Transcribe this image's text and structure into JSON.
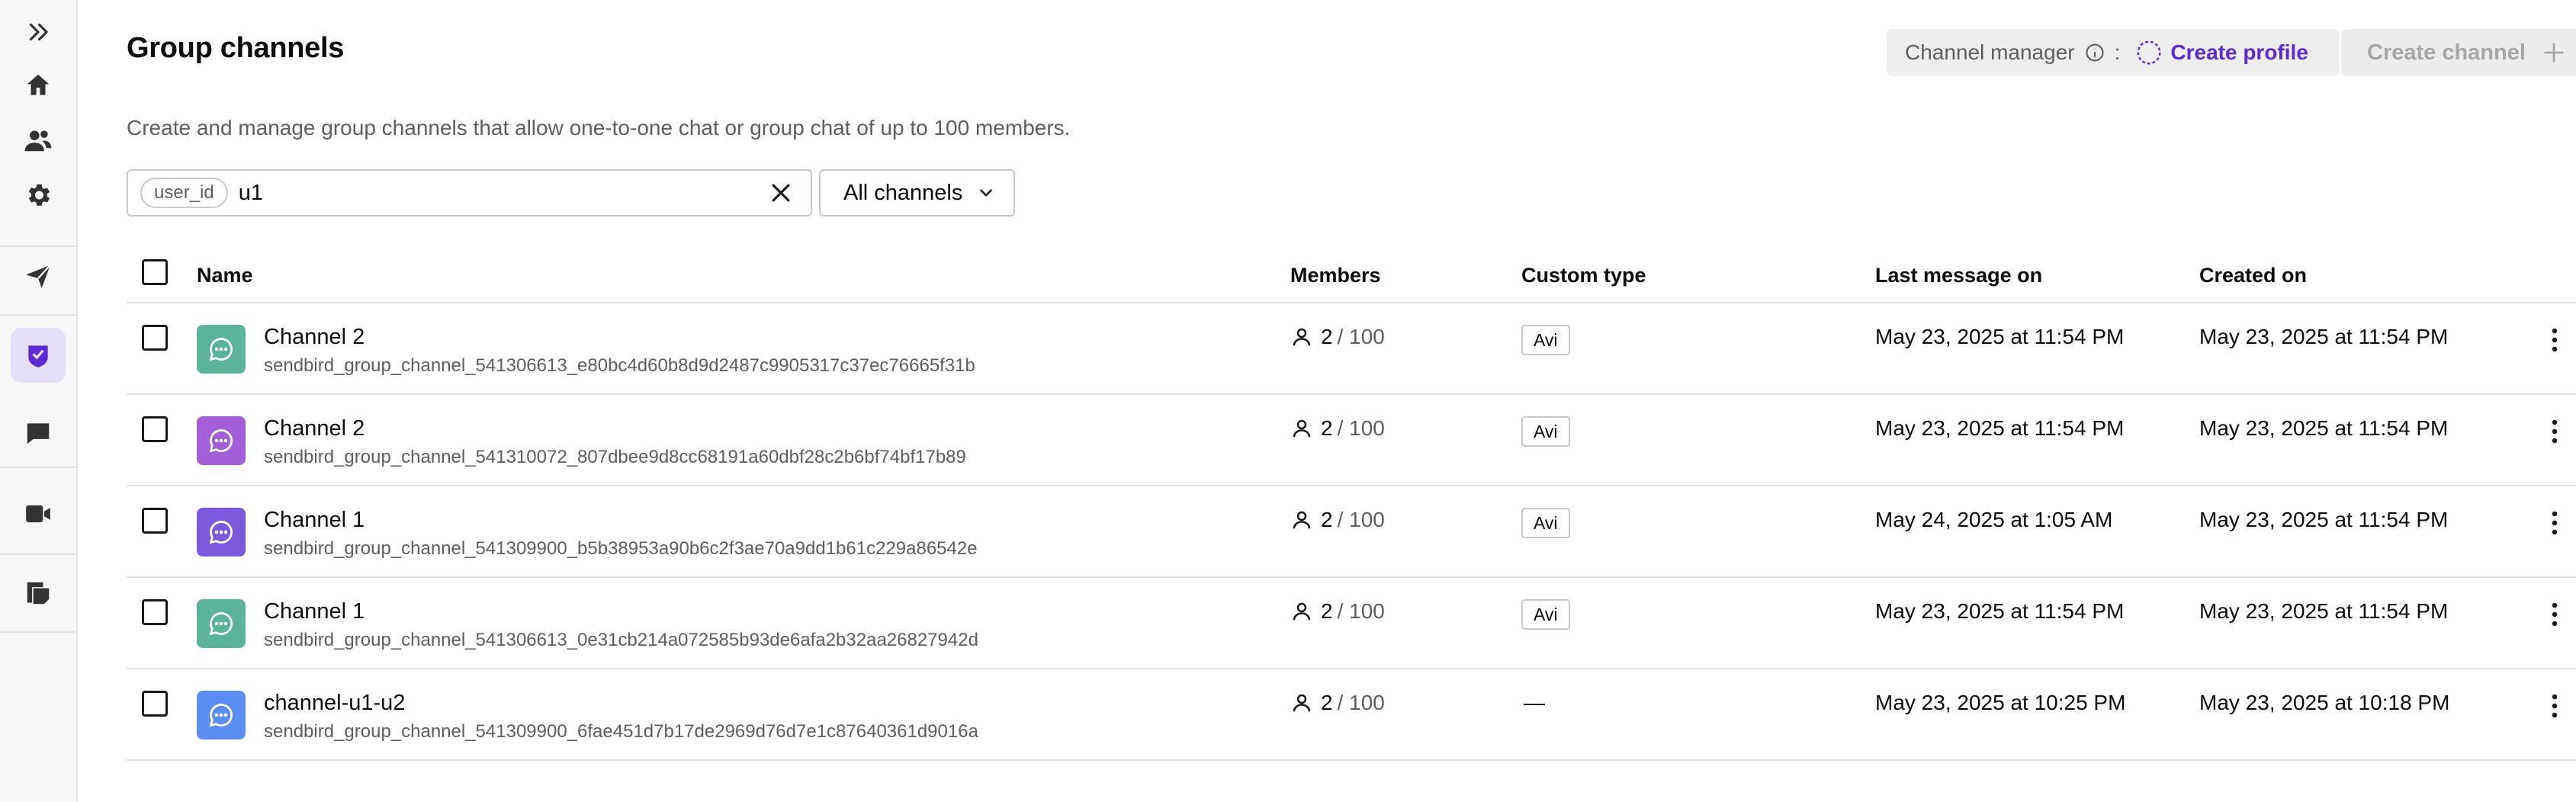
{
  "page": {
    "title": "Group channels",
    "description": "Create and manage group channels that allow one-to-one chat or group chat of up to 100 members."
  },
  "header": {
    "channel_manager_label": "Channel manager",
    "channel_manager_colon": ":",
    "create_profile_label": "Create profile",
    "create_channel_label": "Create channel"
  },
  "search": {
    "filter_chip": "user_id",
    "value": "u1"
  },
  "channel_filter": {
    "selected": "All channels"
  },
  "table": {
    "columns": {
      "name": "Name",
      "members": "Members",
      "custom_type": "Custom type",
      "last_message_on": "Last message on",
      "created_on": "Created on"
    },
    "rows": [
      {
        "name": "Channel 2",
        "url": "sendbird_group_channel_541306613_e80bc4d60b8d9d2487c9905317c37ec76665f31b",
        "members": "2",
        "max_members": "/ 100",
        "custom_type": "Avi",
        "last_message_on": "May 23, 2025 at 11:54 PM",
        "created_on": "May 23, 2025 at 11:54 PM",
        "avatar_color": "#5bb39a"
      },
      {
        "name": "Channel 2",
        "url": "sendbird_group_channel_541310072_807dbee9d8cc68191a60dbf28c2b6bf74bf17b89",
        "members": "2",
        "max_members": "/ 100",
        "custom_type": "Avi",
        "last_message_on": "May 23, 2025 at 11:54 PM",
        "created_on": "May 23, 2025 at 11:54 PM",
        "avatar_color": "#a35ed8"
      },
      {
        "name": "Channel 1",
        "url": "sendbird_group_channel_541309900_b5b38953a90b6c2f3ae70a9dd1b61c229a86542e",
        "members": "2",
        "max_members": "/ 100",
        "custom_type": "Avi",
        "last_message_on": "May 24, 2025 at 1:05 AM",
        "created_on": "May 23, 2025 at 11:54 PM",
        "avatar_color": "#7b5bdb"
      },
      {
        "name": "Channel 1",
        "url": "sendbird_group_channel_541306613_0e31cb214a072585b93de6afa2b32aa26827942d",
        "members": "2",
        "max_members": "/ 100",
        "custom_type": "Avi",
        "last_message_on": "May 23, 2025 at 11:54 PM",
        "created_on": "May 23, 2025 at 11:54 PM",
        "avatar_color": "#5bb39a"
      },
      {
        "name": "channel-u1-u2",
        "url": "sendbird_group_channel_541309900_6fae451d7b17de2969d76d7e1c87640361d9016a",
        "members": "2",
        "max_members": "/ 100",
        "custom_type": "—",
        "last_message_on": "May 23, 2025 at 10:25 PM",
        "created_on": "May 23, 2025 at 10:18 PM",
        "avatar_color": "#5b8ef0"
      }
    ]
  },
  "sidebar": {
    "items": [
      {
        "icon": "expand-icon"
      },
      {
        "icon": "home-icon"
      },
      {
        "icon": "users-icon"
      },
      {
        "icon": "settings-icon"
      },
      {
        "icon": "send-icon"
      },
      {
        "icon": "moderation-icon",
        "active": true
      },
      {
        "icon": "chat-icon"
      },
      {
        "icon": "video-call-icon"
      },
      {
        "icon": "notes-icon"
      }
    ]
  },
  "colors": {
    "accent": "#5b2bd3",
    "active_sidebar_bg": "#e6e0f8"
  }
}
